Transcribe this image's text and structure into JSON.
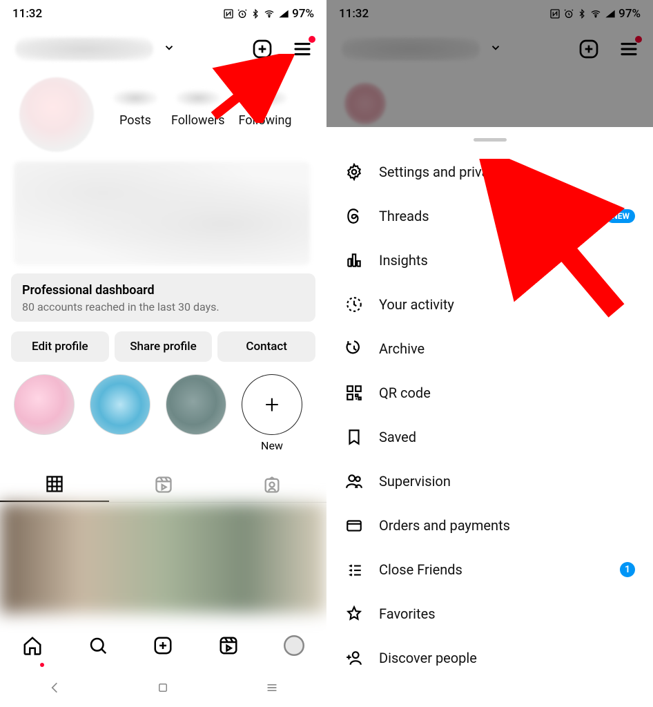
{
  "statusbar": {
    "time": "11:32",
    "battery": "97%"
  },
  "topbar": {
    "plus_icon": "plus",
    "menu_icon": "menu"
  },
  "stats": {
    "posts": "Posts",
    "followers": "Followers",
    "following": "Following"
  },
  "dashboard": {
    "title": "Professional dashboard",
    "subtitle": "80 accounts reached in the last 30 days."
  },
  "buttons": {
    "edit": "Edit profile",
    "share": "Share profile",
    "contact": "Contact"
  },
  "highlights": {
    "new_label": "New"
  },
  "menu": {
    "items": [
      {
        "label": "Settings and privacy",
        "icon": "gear"
      },
      {
        "label": "Threads",
        "icon": "threads",
        "badge_new": "NEW"
      },
      {
        "label": "Insights",
        "icon": "chart"
      },
      {
        "label": "Your activity",
        "icon": "activity"
      },
      {
        "label": "Archive",
        "icon": "archive"
      },
      {
        "label": "QR code",
        "icon": "qr"
      },
      {
        "label": "Saved",
        "icon": "bookmark"
      },
      {
        "label": "Supervision",
        "icon": "supervision"
      },
      {
        "label": "Orders and payments",
        "icon": "card"
      },
      {
        "label": "Close Friends",
        "icon": "close-friends",
        "badge_count": "1"
      },
      {
        "label": "Favorites",
        "icon": "star"
      },
      {
        "label": "Discover people",
        "icon": "discover"
      }
    ]
  }
}
